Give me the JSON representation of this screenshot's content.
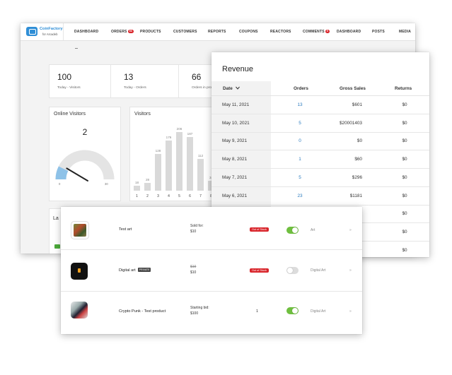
{
  "nav": {
    "logo_name": "CoinFactory",
    "logo_sub": "for Arcadeb",
    "items": [
      {
        "label": "DASHBOARD"
      },
      {
        "label": "ORDERS",
        "badge": "56"
      },
      {
        "label": "PRODUCTS"
      },
      {
        "label": "CUSTOMERS"
      },
      {
        "label": "REPORTS"
      },
      {
        "label": "COUPONS"
      },
      {
        "label": "REACTORS"
      },
      {
        "label": "COMMENTS",
        "badge": "5"
      },
      {
        "label": "DASHBOARD"
      },
      {
        "label": "POSTS"
      },
      {
        "label": "MEDIA"
      }
    ]
  },
  "stats": [
    {
      "value": "100",
      "label": "Today - Visitors"
    },
    {
      "value": "13",
      "label": "Today - Orders"
    },
    {
      "value": "66",
      "label": "Orders in pro"
    }
  ],
  "online_visitors": {
    "title": "Online Visitors",
    "value": "2",
    "gauge_min": "0",
    "gauge_max": "30",
    "gauge_fraction": 0.067,
    "colors": {
      "track": "#e4e4e4",
      "fill": "#8ec2e8",
      "needle": "#222222"
    }
  },
  "visitors_chart": {
    "title": "Visitors"
  },
  "chart_data": {
    "type": "bar",
    "categories": [
      "1",
      "2",
      "3",
      "4",
      "5",
      "6",
      "7",
      "8"
    ],
    "values": [
      18,
      28,
      128,
      176,
      206,
      187,
      112,
      34
    ],
    "ylim": [
      0,
      240
    ],
    "grid": false,
    "bar_color": "#d9d9d9"
  },
  "last_panel": {
    "title": "La"
  },
  "revenue": {
    "title": "Revenue",
    "headers": {
      "date": "Date",
      "orders": "Orders",
      "gross": "Gross Sales",
      "returns": "Returns"
    },
    "sort_icon": "chevron-down-icon",
    "rows": [
      {
        "date": "May 11, 2021",
        "orders": "13",
        "gross": "$601",
        "returns": "$0"
      },
      {
        "date": "May 10, 2021",
        "orders": "5",
        "gross": "$20001403",
        "returns": "$0"
      },
      {
        "date": "May 9, 2021",
        "orders": "0",
        "gross": "$0",
        "returns": "$0"
      },
      {
        "date": "May 8, 2021",
        "orders": "1",
        "gross": "$60",
        "returns": "$0"
      },
      {
        "date": "May 7, 2021",
        "orders": "5",
        "gross": "$296",
        "returns": "$0"
      },
      {
        "date": "May 6, 2021",
        "orders": "23",
        "gross": "$1181",
        "returns": "$0"
      },
      {
        "date": "",
        "orders": "",
        "gross": "",
        "returns": "$0"
      },
      {
        "date": "",
        "orders": "",
        "gross": "",
        "returns": "$0"
      },
      {
        "date": "",
        "orders": "",
        "gross": "",
        "returns": "$0"
      }
    ],
    "accent": "#2a7bbf"
  },
  "products": [
    {
      "name": "Test art",
      "tag": "",
      "price_label": "Sold for:",
      "price": "$10",
      "status": "Out of Stock",
      "qty": "",
      "enabled": true,
      "category": "Art",
      "more": "»"
    },
    {
      "name": "Digital art",
      "tag": "PRIVATE",
      "price_label": "$19",
      "price": "$10",
      "status": "Out of Stock",
      "qty": "",
      "enabled": false,
      "category": "Digital Art",
      "more": "»"
    },
    {
      "name": "Crypto Punk - Test product",
      "tag": "",
      "price_label": "Starting bid:",
      "price": "$100",
      "status": "",
      "qty": "1",
      "enabled": true,
      "category": "Digital Art",
      "more": "»"
    }
  ],
  "colors": {
    "badge_red": "#d9262c",
    "toggle_on": "#6fbf3f",
    "toggle_off": "#dcdcdc"
  }
}
